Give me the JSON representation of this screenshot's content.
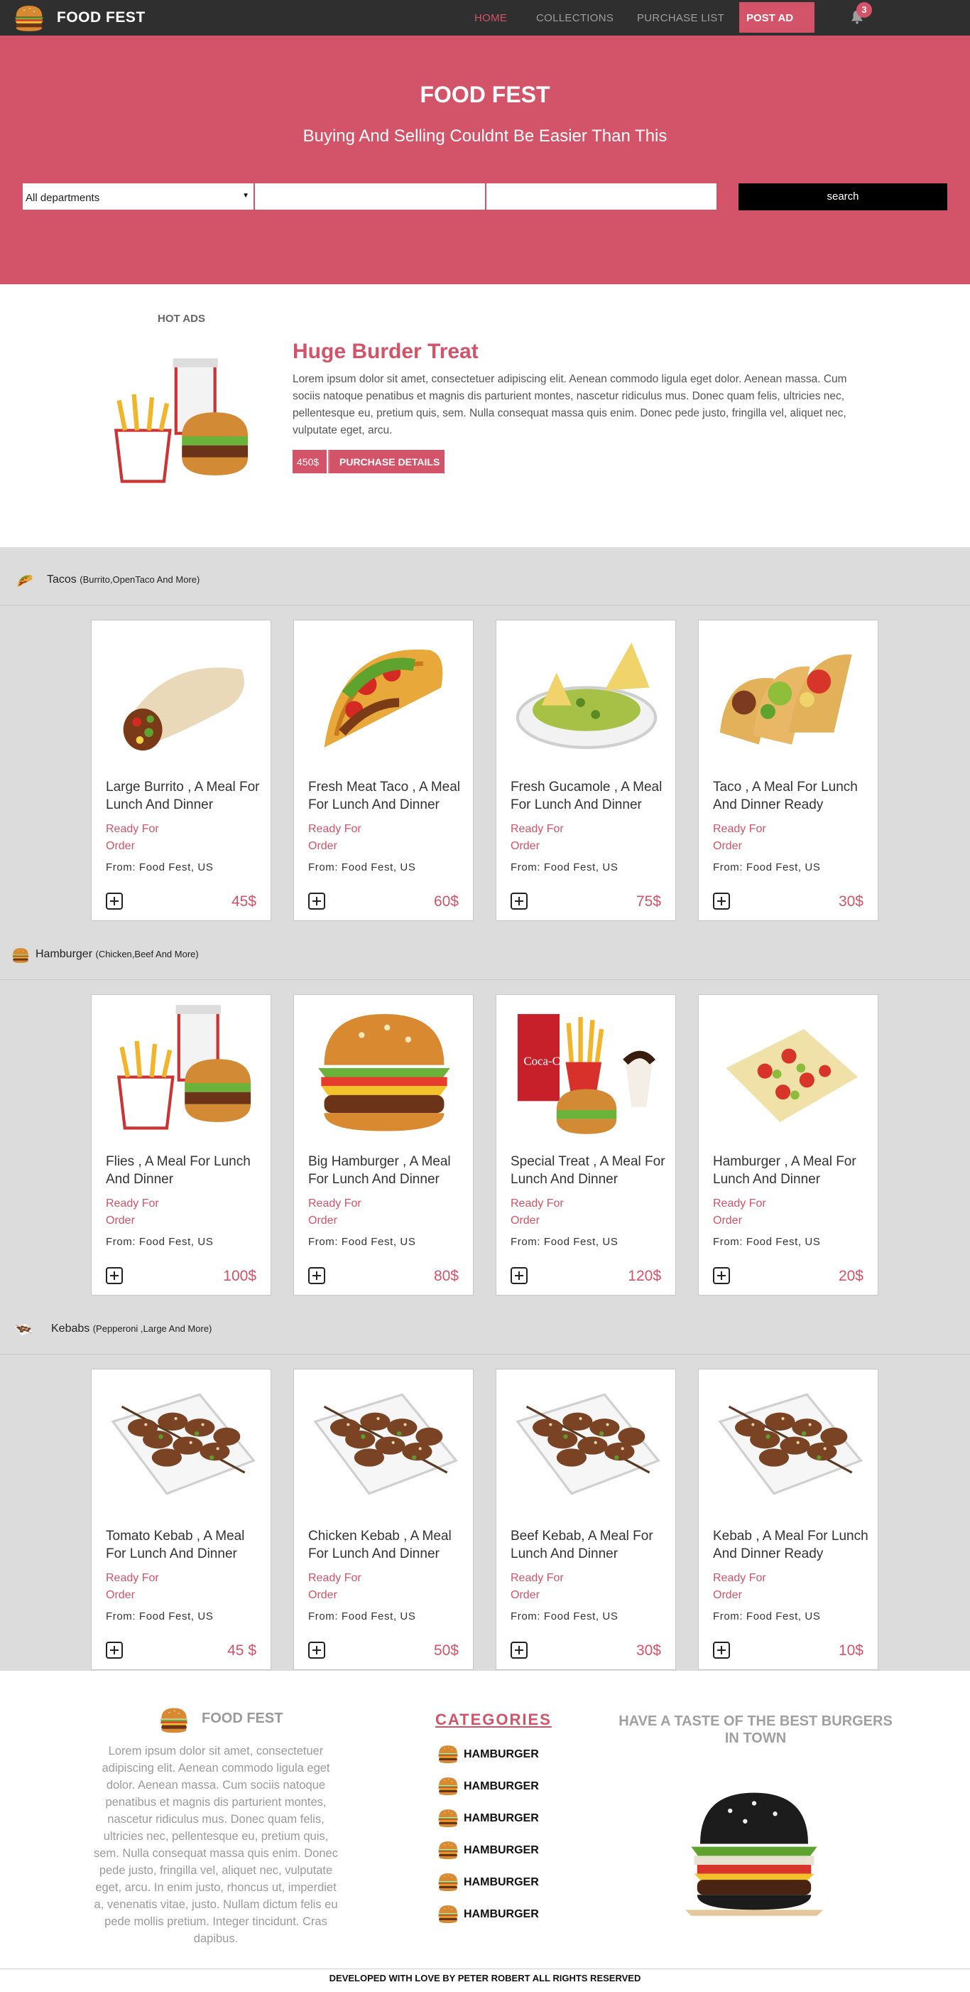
{
  "brand": {
    "name": "FOOD FEST"
  },
  "nav": {
    "home": "HOME",
    "collections": "COLLECTIONS",
    "purchase_list": "PURCHASE LIST",
    "post_ad": "POST AD",
    "notification_count": "3"
  },
  "hero": {
    "title": "FOOD FEST",
    "subtitle": "Buying And Selling Couldnt Be Easier Than This",
    "department_value": "All departments",
    "search_button": "search"
  },
  "hot_ad": {
    "label": "HOT ADS",
    "title": "Huge Burder Treat",
    "description": "Lorem ipsum dolor sit amet, consectetuer adipiscing elit. Aenean commodo ligula eget dolor. Aenean massa. Cum sociis natoque penatibus et magnis dis parturient montes, nascetur ridiculus mus. Donec quam felis, ultricies nec, pellentesque eu, pretium quis, sem. Nulla consequat massa quis enim. Donec pede justo, fringilla vel, aliquet nec, vulputate eget, arcu.",
    "price": "450$",
    "button": "PURCHASE DETAILS"
  },
  "categories": [
    {
      "name": "Tacos",
      "sub": "(Burrito,OpenTaco And More)",
      "icon": "taco-icon",
      "items": [
        {
          "title": "Large Burrito , A Meal For Lunch And Dinner",
          "status": "Ready For Order",
          "from": "From: Food Fest, US",
          "price": "45$",
          "image": "burrito"
        },
        {
          "title": "Fresh Meat Taco , A Meal For Lunch And Dinner",
          "status": "Ready For Order",
          "from": "From: Food Fest, US",
          "price": "60$",
          "image": "taco"
        },
        {
          "title": "Fresh Gucamole , A Meal For Lunch And Dinner",
          "status": "Ready For Order",
          "from": "From: Food Fest, US",
          "price": "75$",
          "image": "guacamole"
        },
        {
          "title": "Taco , A Meal For Lunch And Dinner Ready",
          "status": "Ready For Order",
          "from": "From: Food Fest, US",
          "price": "30$",
          "image": "tacos-row"
        }
      ]
    },
    {
      "name": "Hamburger",
      "sub": "(Chicken,Beef And More)",
      "icon": "burger-icon",
      "items": [
        {
          "title": "Flies , A Meal For Lunch And Dinner",
          "status": "Ready For Order",
          "from": "From: Food Fest, US",
          "price": "100$",
          "image": "combo"
        },
        {
          "title": "Big Hamburger , A Meal For Lunch And Dinner",
          "status": "Ready For Order",
          "from": "From: Food Fest, US",
          "price": "80$",
          "image": "big-burger"
        },
        {
          "title": "Special Treat , A Meal For Lunch And Dinner",
          "status": "Ready For Order",
          "from": "From: Food Fest, US",
          "price": "120$",
          "image": "cola-meal"
        },
        {
          "title": "Hamburger , A Meal For Lunch And Dinner",
          "status": "Ready For Order",
          "from": "From: Food Fest, US",
          "price": "20$",
          "image": "flatbread"
        }
      ]
    },
    {
      "name": "Kebabs",
      "sub": "(Pepperoni ,Large And More)",
      "icon": "kebab-icon",
      "items": [
        {
          "title": "Tomato Kebab , A Meal For Lunch And Dinner",
          "status": "Ready For Order",
          "from": "From: Food Fest, US",
          "price": "45 $",
          "image": "kebab"
        },
        {
          "title": "Chicken Kebab , A Meal For Lunch And Dinner",
          "status": "Ready For Order",
          "from": "From: Food Fest, US",
          "price": "50$",
          "image": "kebab"
        },
        {
          "title": "Beef Kebab, A Meal For Lunch And Dinner",
          "status": "Ready For Order",
          "from": "From: Food Fest, US",
          "price": "30$",
          "image": "kebab"
        },
        {
          "title": "Kebab , A Meal For Lunch And Dinner Ready",
          "status": "Ready For Order",
          "from": "From: Food Fest, US",
          "price": "10$",
          "image": "kebab"
        }
      ]
    }
  ],
  "footer": {
    "brand": "FOOD FEST",
    "about": "Lorem ipsum dolor sit amet, consectetuer adipiscing elit. Aenean commodo ligula eget dolor. Aenean massa. Cum sociis natoque penatibus et magnis dis parturient montes, nascetur ridiculus mus. Donec quam felis, ultricies nec, pellentesque eu, pretium quis, sem. Nulla consequat massa quis enim. Donec pede justo, fringilla vel, aliquet nec, vulputate eget, arcu. In enim justo, rhoncus ut, imperdiet a, venenatis vitae, justo. Nullam dictum felis eu pede mollis pretium. Integer tincidunt. Cras dapibus.",
    "categories_title": "CATEGORIES",
    "categories": [
      "HAMBURGER",
      "HAMBURGER",
      "HAMBURGER",
      "HAMBURGER",
      "HAMBURGER",
      "HAMBURGER"
    ],
    "taste": "HAVE A TASTE OF THE BEST BURGERS IN TOWN",
    "copyright": "DEVELOPED WITH LOVE BY PETER ROBERT ALL RIGHTS RESERVED"
  },
  "colors": {
    "accent": "#d35369",
    "nav_bg": "#2f2f2f",
    "section_bg": "#dcdcdc"
  }
}
